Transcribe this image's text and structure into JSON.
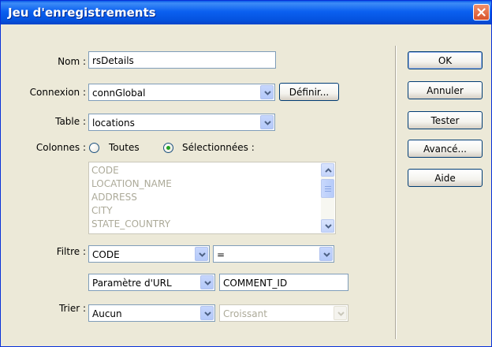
{
  "dialog": {
    "title": "Jeu d'enregistrements"
  },
  "form": {
    "name_label": "Nom :",
    "name_value": "rsDetails",
    "connection_label": "Connexion :",
    "connection_value": "connGlobal",
    "define_button": "Définir...",
    "table_label": "Table :",
    "table_value": "locations",
    "columns_label": "Colonnes :",
    "columns_all": "Toutes",
    "columns_selected": "Sélectionnées :",
    "columns_choice": "selected",
    "columns_list": [
      "CODE",
      "LOCATION_NAME",
      "ADDRESS",
      "CITY",
      "STATE_COUNTRY"
    ],
    "filter_label": "Filtre :",
    "filter_column": "CODE",
    "filter_operator": "=",
    "filter_param_type": "Paramètre d'URL",
    "filter_param_value": "COMMENT_ID",
    "sort_label": "Trier :",
    "sort_column": "Aucun",
    "sort_order": "Croissant"
  },
  "buttons": {
    "ok": "OK",
    "cancel": "Annuler",
    "test": "Tester",
    "advanced": "Avancé...",
    "help": "Aide"
  },
  "icons": {
    "close": "close-icon",
    "dropdown": "chevron-down-icon",
    "scroll_up": "scroll-up-arrow-icon",
    "scroll_down": "scroll-down-arrow-icon"
  },
  "colors": {
    "titlebar": "#0553e0",
    "close_button": "#d8532c",
    "dialog_bg": "#ece9d8",
    "input_border": "#7f9db9",
    "disabled_text": "#acaa99",
    "radio_dot": "#21a121"
  }
}
